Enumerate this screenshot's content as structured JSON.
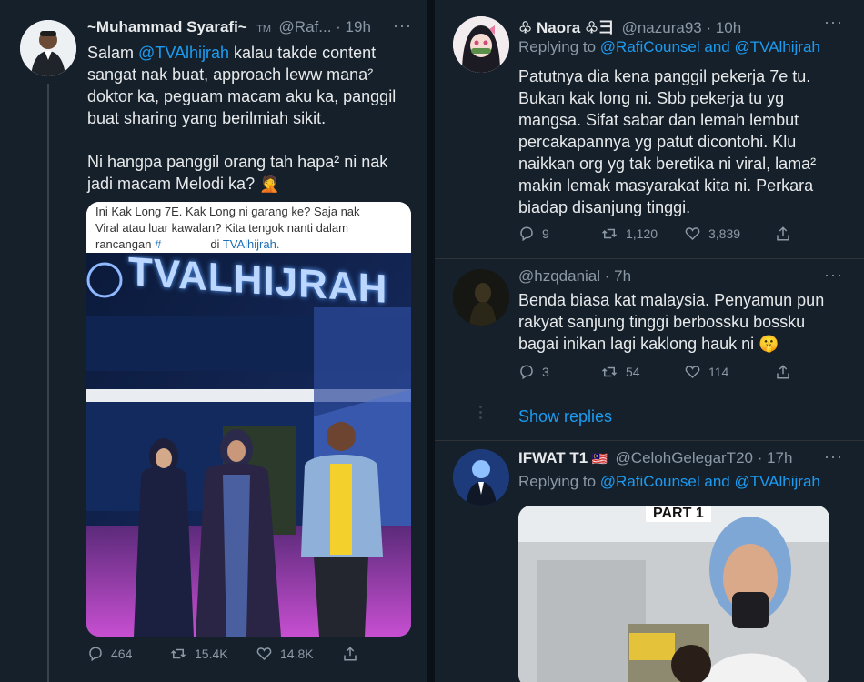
{
  "left": {
    "author": "~Muhammad Syarafi~",
    "author_badge": "TM",
    "handle_time": "@Raf... · 19h",
    "text_mention": "@TVAlhijrah",
    "text_line1": "kalau takde content",
    "text_line2": "sangat nak buat, approach leww mana²",
    "text_line3": "doktor ka, peguam macam aku ka, panggil",
    "text_line4": "buat sharing yang berilmiah sikit.",
    "text_line5": "Ni hangpa panggil orang tah hapa² ni nak",
    "text_line6": "jadi macam Melodi ka? 🤦",
    "greeting": "Salam",
    "image_caption1": "Ini Kak Long 7E. Kak Long ni garang ke? Saja nak",
    "image_caption2": "Viral atau luar kawalan? Kita tengok nanti dalam",
    "image_caption3_a": "rancangan",
    "image_caption3_hash": "#",
    "image_caption3_b": "di",
    "image_caption3_link": "TVAlhijrah.",
    "image_sign": "TVALHIJRAH",
    "replies": "464",
    "retweets": "15.4K",
    "likes": "14.8K"
  },
  "right": {
    "t1": {
      "author": "♧ Naora ♧⺕",
      "handle_time": "@nazura93 · 10h",
      "replying": "Replying to",
      "replying_to": "@RafiCounsel and @TVAlhijrah",
      "lines": [
        "Patutnya dia kena panggil pekerja 7e tu.",
        "Bukan kak long ni. Sbb pekerja tu yg",
        "mangsa. Sifat sabar dan lemah lembut",
        "percakapannya yg patut dicontohi. Klu",
        "naikkan org yg tak beretika ni viral, lama²",
        "makin lemak masyarakat kita ni. Perkara",
        "biadap disanjung tinggi."
      ],
      "replies": "9",
      "retweets": "1,120",
      "likes": "3,839"
    },
    "t2": {
      "handle_time": "@hzqdanial · 7h",
      "lines": [
        "Benda biasa kat malaysia. Penyamun pun",
        "rakyat sanjung tinggi berbossku bossku",
        "bagai inikan lagi kaklong hauk ni 🤫"
      ],
      "replies": "3",
      "retweets": "54",
      "likes": "114"
    },
    "show_replies": "Show replies",
    "t3": {
      "author": "IFWAT T1",
      "flag": "🇲🇾",
      "handle_time": "@CelohGelegarT20 · 17h",
      "replying": "Replying to",
      "replying_to": "@RafiCounsel and @TVAlhijrah",
      "video_label": "PART 1"
    }
  }
}
